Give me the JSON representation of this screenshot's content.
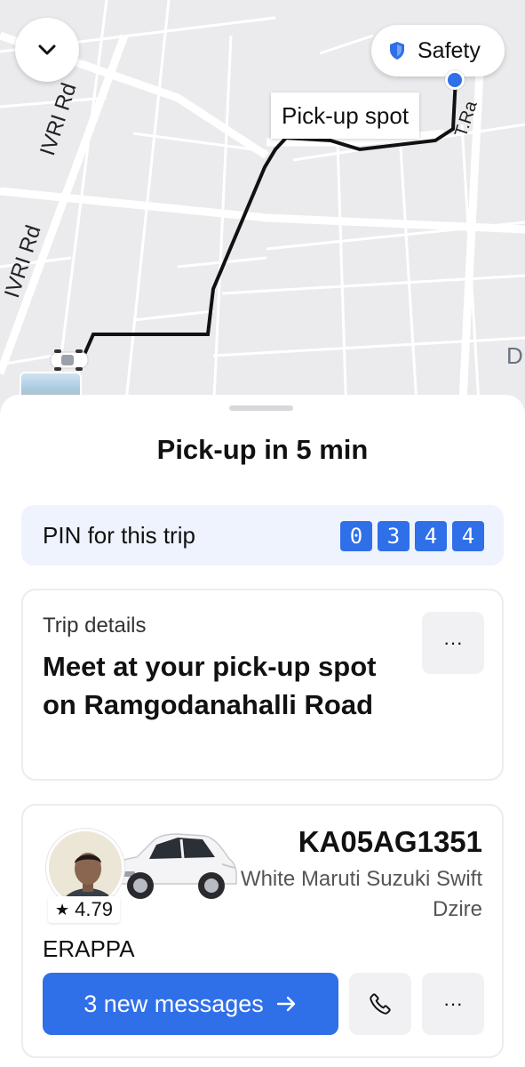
{
  "map": {
    "road_labels": [
      "IVRI Rd",
      "IVRI Rd",
      "T.Ra"
    ],
    "edge_letter": "D",
    "pickup_label": "Pick-up spot",
    "safety_label": "Safety",
    "route_color": "#111111",
    "pickup_dot_color": "#2f6fe8"
  },
  "sheet": {
    "title": "Pick-up in 5 min",
    "pin": {
      "label": "PIN for this trip",
      "digits": [
        "0",
        "3",
        "4",
        "4"
      ]
    },
    "trip": {
      "subtitle": "Trip details",
      "main": "Meet at your pick-up spot on Ramgodanahalli Road",
      "more": "···"
    },
    "driver": {
      "rating": "4.79",
      "name": "ERAPPA",
      "plate": "KA05AG1351",
      "vehicle": "White Maruti Suzuki Swift Dzire",
      "messages_label": "3 new messages",
      "more": "···"
    }
  },
  "colors": {
    "accent": "#2f6fe8",
    "pin_bg": "#eef3fd"
  }
}
